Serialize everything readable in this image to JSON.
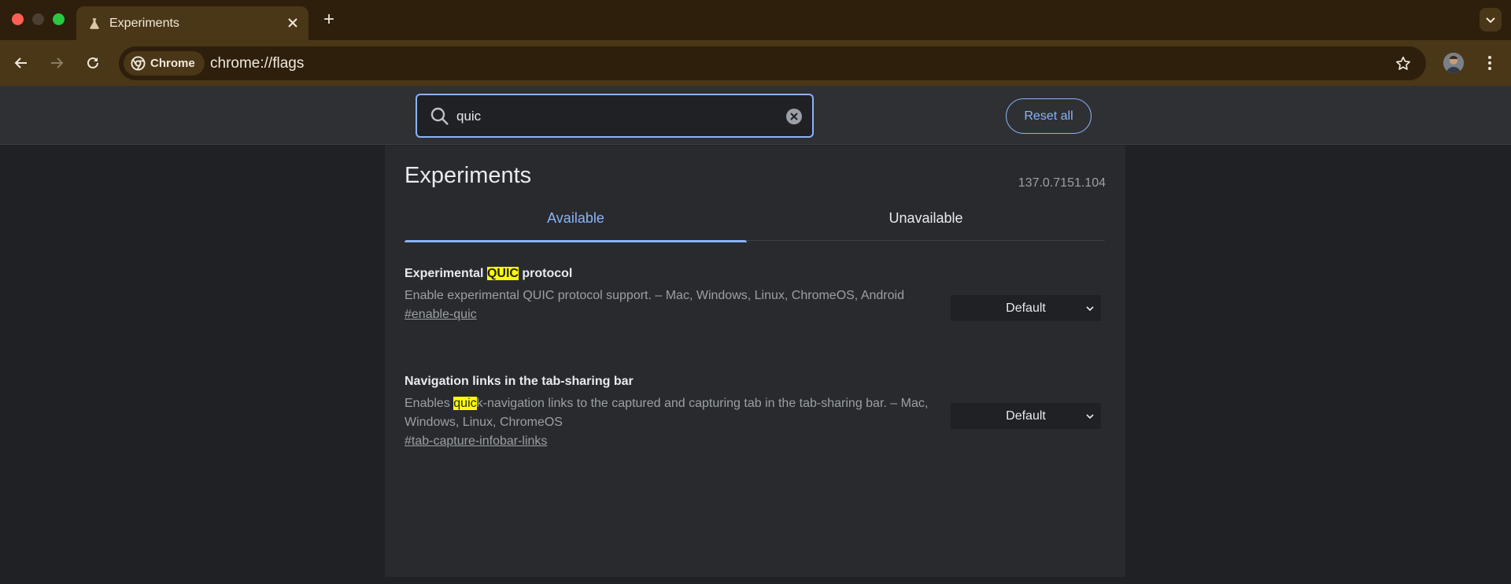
{
  "browser": {
    "tab_title": "Experiments",
    "new_tab_symbol": "+",
    "chip_label": "Chrome",
    "url": "chrome://flags"
  },
  "header": {
    "search_value": "quic",
    "reset_label": "Reset all"
  },
  "page": {
    "title": "Experiments",
    "version": "137.0.7151.104",
    "tabs": [
      {
        "label": "Available",
        "selected": true
      },
      {
        "label": "Unavailable",
        "selected": false
      }
    ]
  },
  "flags": [
    {
      "name_before": "Experimental ",
      "name_highlight": "QUIC",
      "name_after": " protocol",
      "desc_before": "Enable experimental QUIC protocol support. – Mac, Windows, Linux, ChromeOS, Android",
      "desc_highlight": "",
      "desc_after": "",
      "link": "#enable-quic",
      "value": "Default"
    },
    {
      "name_before": "Navigation links in the tab-sharing bar",
      "name_highlight": "",
      "name_after": "",
      "desc_before": "Enables ",
      "desc_highlight": "quic",
      "desc_after": "k-navigation links to the captured and capturing tab in the tab-sharing bar. – Mac, Windows, Linux, ChromeOS",
      "link": "#tab-capture-infobar-links",
      "value": "Default"
    }
  ],
  "colors": {
    "accent": "#8ab4f8",
    "highlight": "#ffff00",
    "frame": "#4a3718"
  },
  "icons": [
    "flask-icon",
    "close-icon",
    "plus-icon",
    "chevron-down-icon",
    "back-arrow-icon",
    "forward-arrow-icon",
    "reload-icon",
    "chrome-logo-icon",
    "star-icon",
    "avatar",
    "more-vert-icon",
    "search-icon",
    "clear-icon"
  ]
}
